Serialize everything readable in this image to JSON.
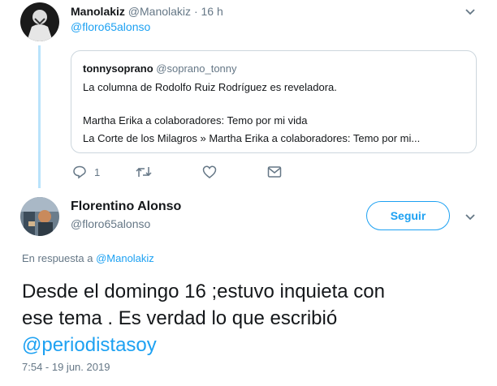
{
  "tweet1": {
    "name": "Manolakiz",
    "handle": "@Manolakiz",
    "sep": "·",
    "time": "16 h",
    "reply_to": "@floro65alonso",
    "quote": {
      "name": "tonnysoprano",
      "handle": "@soprano_tonny",
      "line1": "La columna de Rodolfo Ruiz Rodríguez es reveladora.",
      "line2": "Martha Erika a colaboradores: Temo por mi vida",
      "line3": "La Corte de los Milagros » Martha Erika a colaboradores: Temo por mi..."
    },
    "actions": {
      "reply_count": "1"
    }
  },
  "tweet2": {
    "name": "Florentino Alonso",
    "handle": "@floro65alonso",
    "follow_label": "Seguir",
    "replying_prefix": "En respuesta a",
    "replying_handle": "@Manolakiz",
    "text_line1": "Desde el domingo 16 ;estuvo inquieta con",
    "text_line2": "ese tema . Es verdad lo que escribió",
    "mention": "@periodistasoy",
    "timestamp": "7:54 - 19 jun. 2019"
  },
  "colors": {
    "accent": "#1da1f2",
    "muted": "#657786",
    "thread_line": "#b9e3fb"
  }
}
